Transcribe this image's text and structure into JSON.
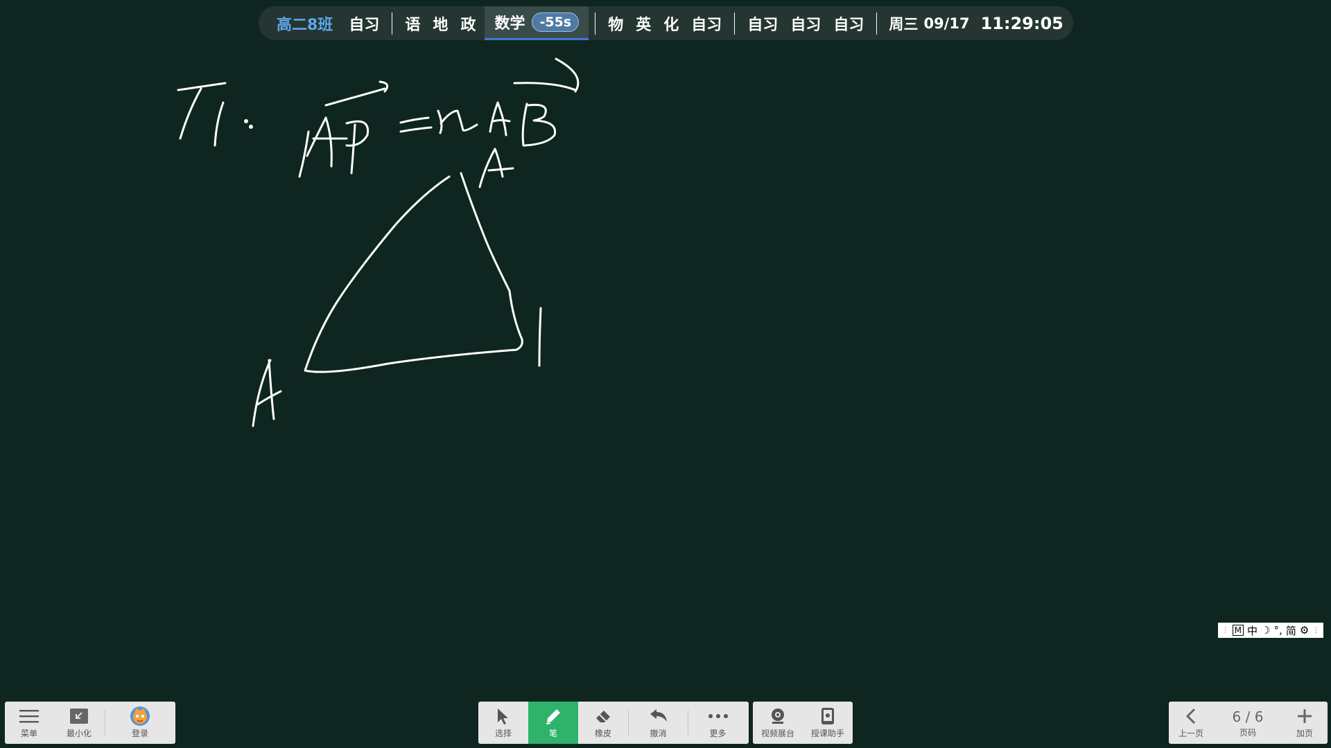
{
  "schedule": {
    "class_name": "高二8班",
    "items": [
      "自习",
      "语",
      "地",
      "政",
      "数学",
      "物",
      "英",
      "化",
      "自习",
      "自习",
      "自习",
      "自习"
    ],
    "current_badge": "-55s",
    "weekday": "周三",
    "date": "09/17",
    "time": "11:29:05",
    "accent": "#3f79d8"
  },
  "ime": {
    "mode": "M",
    "lang": "中",
    "moon": "☽",
    "punct": "°,",
    "script": "简",
    "gear": "⚙"
  },
  "left_toolbar": {
    "menu": "菜单",
    "minimize": "最小化",
    "login": "登录"
  },
  "tools": {
    "select": "选择",
    "pen": "笔",
    "eraser": "橡皮",
    "undo": "撤消",
    "more": "更多",
    "video_booth": "视频展台",
    "teaching_assistant": "授课助手",
    "pen_active_color": "#2fb36a"
  },
  "pager": {
    "prev": "上一页",
    "page_indicator": "6 / 6",
    "page_label": "页码",
    "add": "加页"
  },
  "board": {
    "background": "#0f2520",
    "ink_color": "#ffffff"
  }
}
